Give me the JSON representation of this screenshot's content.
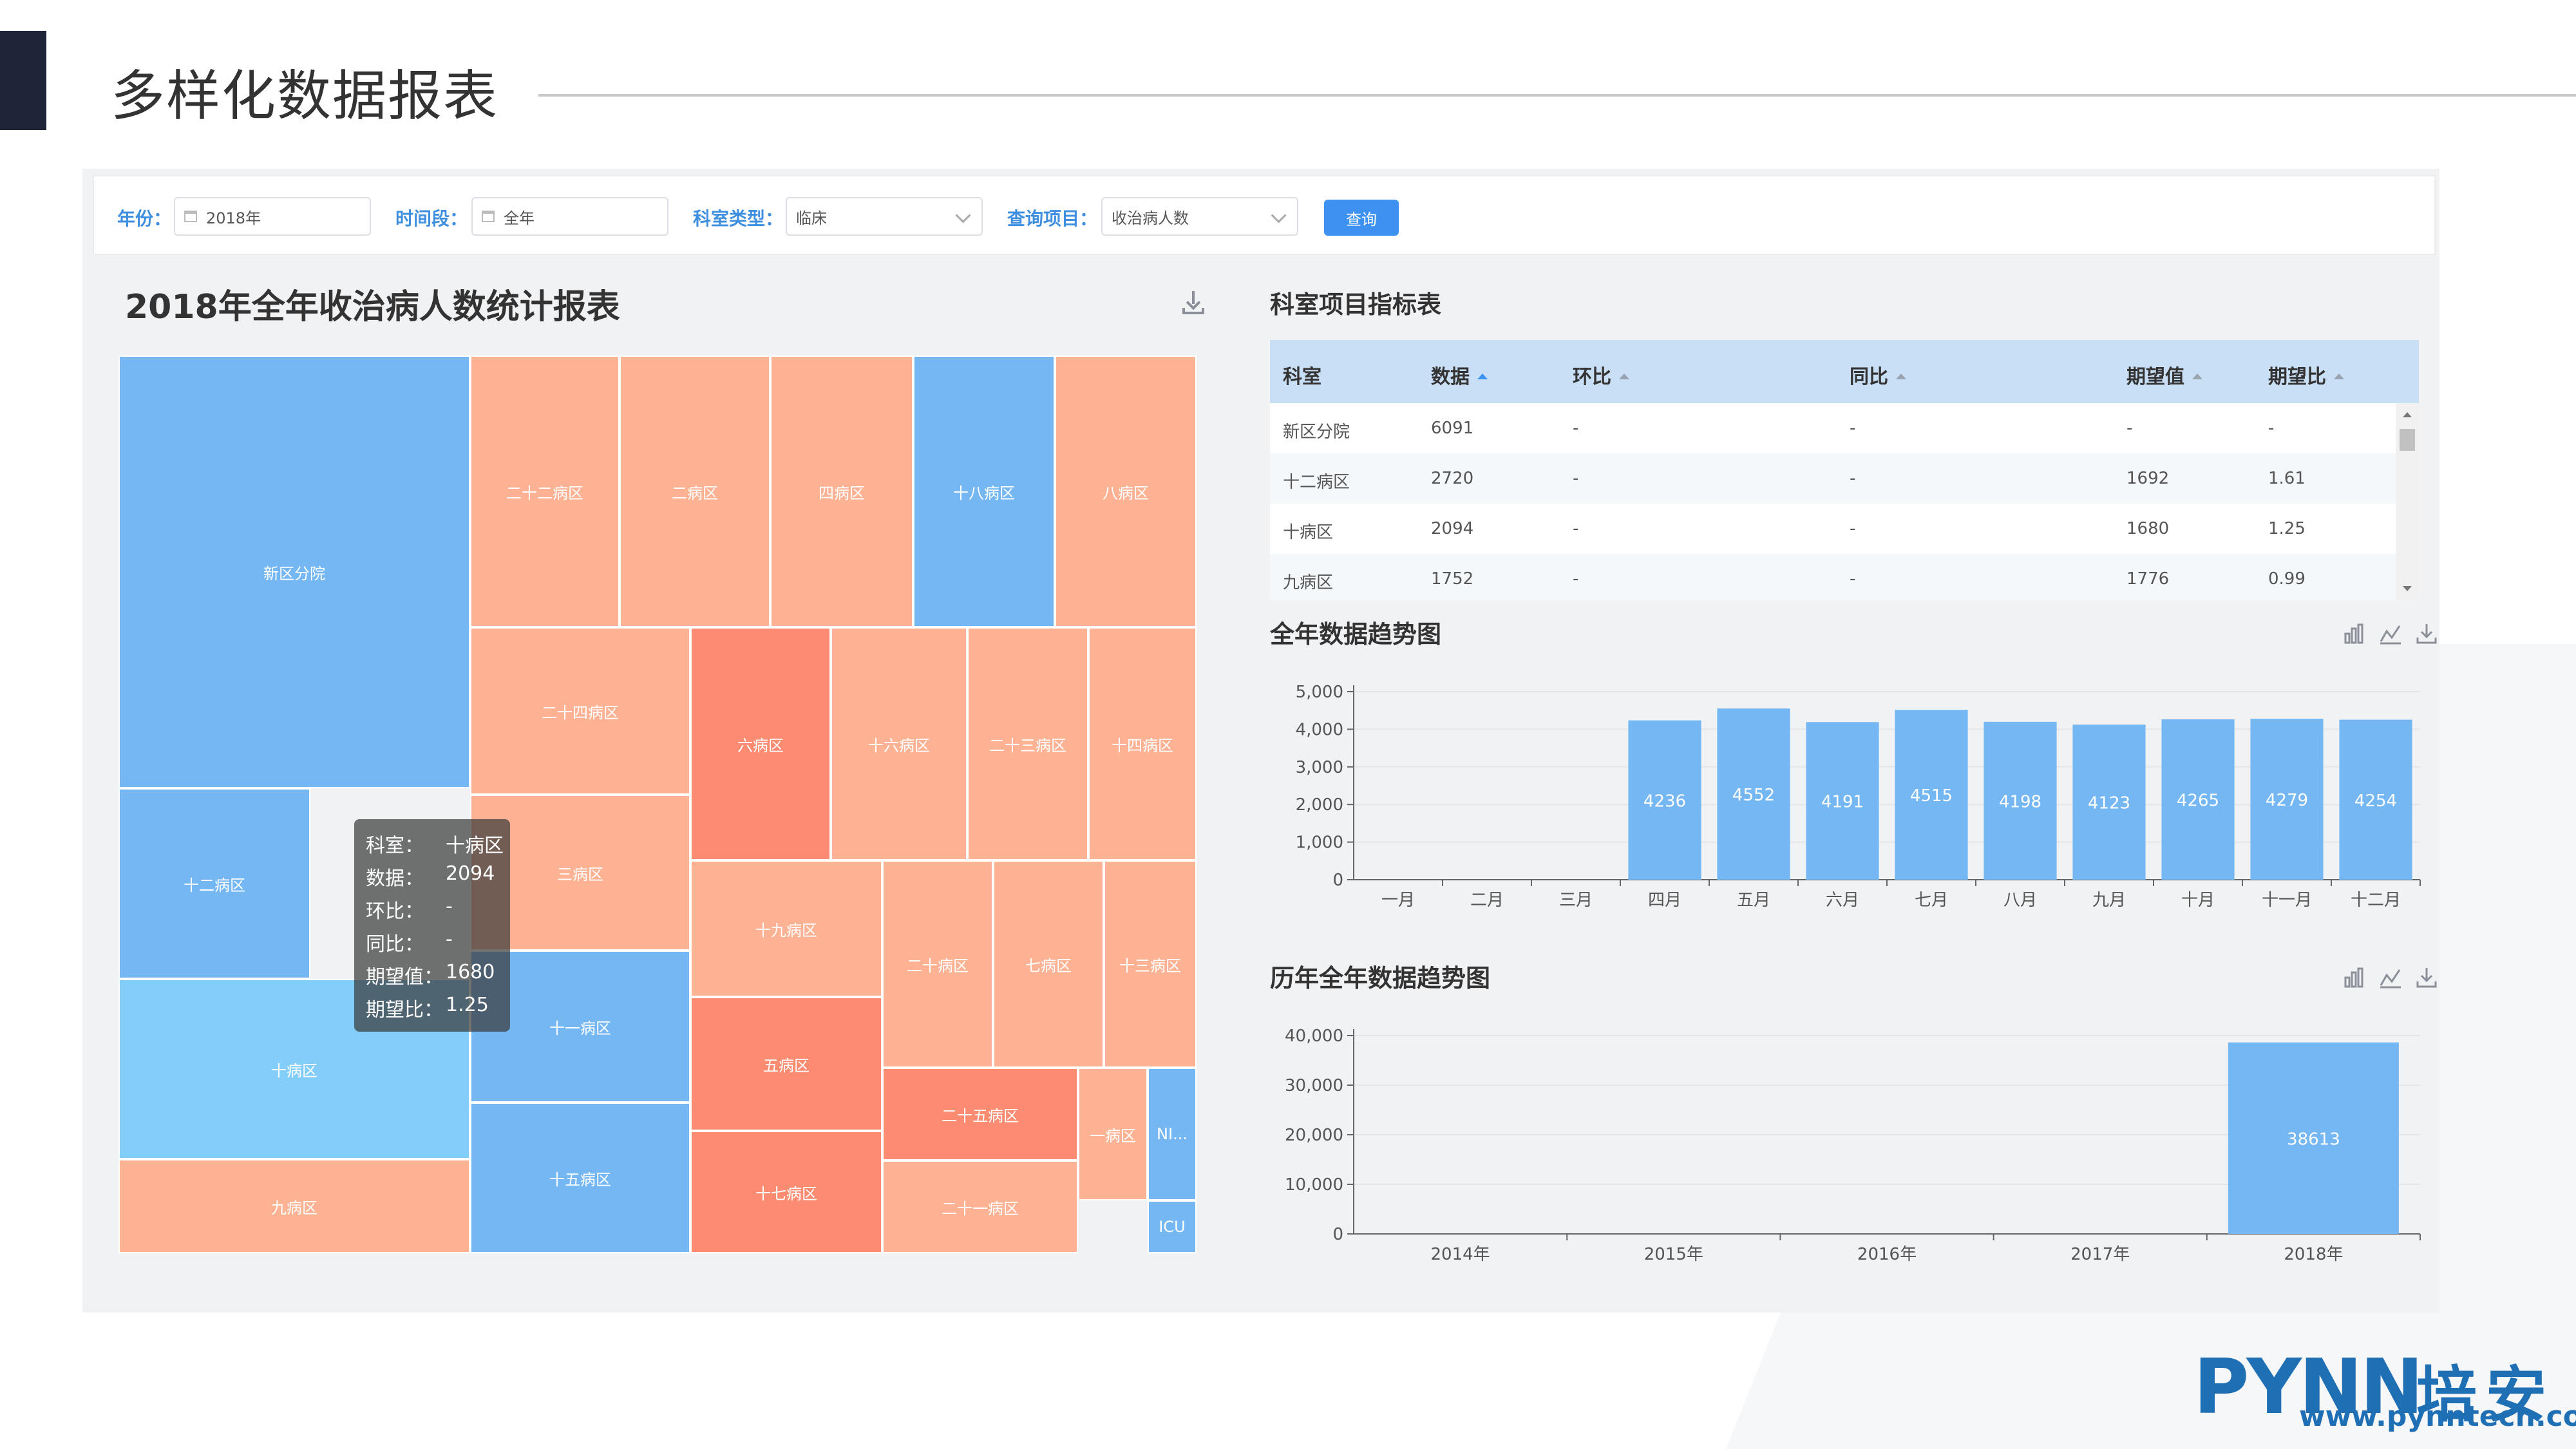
{
  "slide": {
    "title": "多样化数据报表"
  },
  "filters": {
    "year_label": "年份：",
    "year_value": "2018年",
    "period_label": "时间段：",
    "period_value": "全年",
    "dept_type_label": "科室类型：",
    "dept_type_value": "临床",
    "query_item_label": "查询项目：",
    "query_item_value": "收治病人数",
    "query_button": "查询"
  },
  "report": {
    "title": "2018年全年收治病人数统计报表"
  },
  "treemap": {
    "cells": [
      {
        "label": "新区分院",
        "color": "#74b7f3"
      },
      {
        "label": "十二病区",
        "color": "#74b7f3"
      },
      {
        "label": "十病区",
        "color": "#82cdfa"
      },
      {
        "label": "九病区",
        "color": "#fdb293"
      },
      {
        "label": "二十二病区",
        "color": "#fdb293"
      },
      {
        "label": "二病区",
        "color": "#fdb293"
      },
      {
        "label": "四病区",
        "color": "#fdb293"
      },
      {
        "label": "十八病区",
        "color": "#74b7f3"
      },
      {
        "label": "八病区",
        "color": "#fdb293"
      },
      {
        "label": "二十四病区",
        "color": "#fdb293"
      },
      {
        "label": "六病区",
        "color": "#fb8c72"
      },
      {
        "label": "十六病区",
        "color": "#fdb293"
      },
      {
        "label": "二十三病区",
        "color": "#fdb293"
      },
      {
        "label": "十四病区",
        "color": "#fdb293"
      },
      {
        "label": "三病区",
        "color": "#fdb293"
      },
      {
        "label": "十九病区",
        "color": "#fdb293"
      },
      {
        "label": "二十病区",
        "color": "#fdb293"
      },
      {
        "label": "七病区",
        "color": "#fdb293"
      },
      {
        "label": "十三病区",
        "color": "#fdb293"
      },
      {
        "label": "十一病区",
        "color": "#74b7f3"
      },
      {
        "label": "五病区",
        "color": "#fb8c72"
      },
      {
        "label": "二十五病区",
        "color": "#fb8c72"
      },
      {
        "label": "一病区",
        "color": "#fdb293"
      },
      {
        "label": "NI...",
        "color": "#74b7f3"
      },
      {
        "label": "十五病区",
        "color": "#74b7f3"
      },
      {
        "label": "十七病区",
        "color": "#fb8c72"
      },
      {
        "label": "二十一病区",
        "color": "#fdb293"
      },
      {
        "label": "ICU",
        "color": "#74b7f3"
      }
    ],
    "tooltip": {
      "rows": [
        {
          "k": "科室：",
          "v": "十病区"
        },
        {
          "k": "数据：",
          "v": "2094"
        },
        {
          "k": "环比：",
          "v": "-"
        },
        {
          "k": "同比：",
          "v": "-"
        },
        {
          "k": "期望值：",
          "v": "1680"
        },
        {
          "k": "期望比：",
          "v": "1.25"
        }
      ]
    }
  },
  "indicator_table": {
    "title": "科室项目指标表",
    "headers": [
      "科室",
      "数据",
      "环比",
      "同比",
      "期望值",
      "期望比"
    ],
    "rows": [
      [
        "新区分院",
        "6091",
        "-",
        "-",
        "-",
        "-"
      ],
      [
        "十二病区",
        "2720",
        "-",
        "-",
        "1692",
        "1.61"
      ],
      [
        "十病区",
        "2094",
        "-",
        "-",
        "1680",
        "1.25"
      ],
      [
        "九病区",
        "1752",
        "-",
        "-",
        "1776",
        "0.99"
      ]
    ]
  },
  "monthly_chart": {
    "title": "全年数据趋势图"
  },
  "yearly_chart": {
    "title": "历年全年数据趋势图"
  },
  "chart_data": [
    {
      "type": "bar",
      "title": "全年数据趋势图",
      "categories": [
        "一月",
        "二月",
        "三月",
        "四月",
        "五月",
        "六月",
        "七月",
        "八月",
        "九月",
        "十月",
        "十一月",
        "十二月"
      ],
      "values": [
        0,
        0,
        0,
        4236,
        4552,
        4191,
        4515,
        4198,
        4123,
        4265,
        4279,
        4254
      ],
      "data_labels": [
        "",
        "",
        "",
        "4236",
        "4552",
        "4191",
        "4515",
        "4198",
        "4123",
        "4265",
        "4279",
        "4254"
      ],
      "yticks": [
        "0",
        "1,000",
        "2,000",
        "3,000",
        "4,000",
        "5,000"
      ],
      "ylim": [
        0,
        5000
      ],
      "color": "#74b7f3"
    },
    {
      "type": "bar",
      "title": "历年全年数据趋势图",
      "categories": [
        "2014年",
        "2015年",
        "2016年",
        "2017年",
        "2018年"
      ],
      "values": [
        0,
        0,
        0,
        0,
        38613
      ],
      "data_labels": [
        "",
        "",
        "",
        "",
        "38613"
      ],
      "yticks": [
        "0",
        "10,000",
        "20,000",
        "30,000",
        "40,000"
      ],
      "ylim": [
        0,
        40000
      ],
      "color": "#74b7f3"
    }
  ],
  "logo": {
    "brand": "PYNN",
    "cn": "培安",
    "url": "www.pynntech.com"
  }
}
